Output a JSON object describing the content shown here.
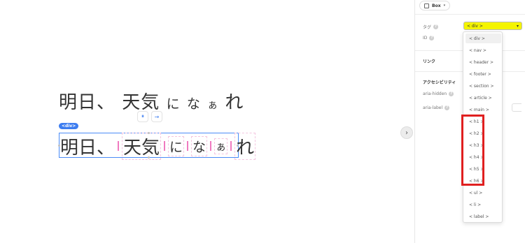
{
  "canvas": {
    "heading_1": {
      "c1": "明日、",
      "c2": "天気",
      "c3": "に",
      "c4": "な",
      "c5": "ぁ",
      "c6": "れ"
    },
    "heading_2": {
      "c1": "明日、",
      "c2": "天気",
      "c3": "に",
      "c4": "な",
      "c5": "ぁ",
      "c6": "れ"
    },
    "element_badge": "<div>",
    "mini_toolbar": {
      "btn_1": "⏸",
      "btn_2": "→"
    },
    "expand_toggle": "›"
  },
  "panel": {
    "box_label": "Box",
    "box_caret": "▾",
    "tag_label": "タグ",
    "id_label": "ID",
    "link_title": "リンク",
    "accessibility_title": "アクセシビリティ",
    "aria_hidden_label": "aria-hidden",
    "aria_label_label": "aria-label",
    "help_glyph": "?",
    "tag_select": {
      "value": "< div >",
      "caret": "▾"
    }
  },
  "dropdown": {
    "options": [
      {
        "label": "< div >"
      },
      {
        "label": "< nav >"
      },
      {
        "label": "< header >"
      },
      {
        "label": "< footer >"
      },
      {
        "label": "< section >"
      },
      {
        "label": "< article >"
      },
      {
        "label": "< main >"
      },
      {
        "label": "< h1 >"
      },
      {
        "label": "< h2 >"
      },
      {
        "label": "< h3 >"
      },
      {
        "label": "< h4 >"
      },
      {
        "label": "< h5 >"
      },
      {
        "label": "< h6 >"
      },
      {
        "label": "< ul >"
      },
      {
        "label": "< li >"
      },
      {
        "label": "< label >"
      }
    ],
    "highlighted": "< div >",
    "annotation_color": "#e02020",
    "select_highlight_color": "#f4f400",
    "accent_color": "#3d7df0"
  }
}
